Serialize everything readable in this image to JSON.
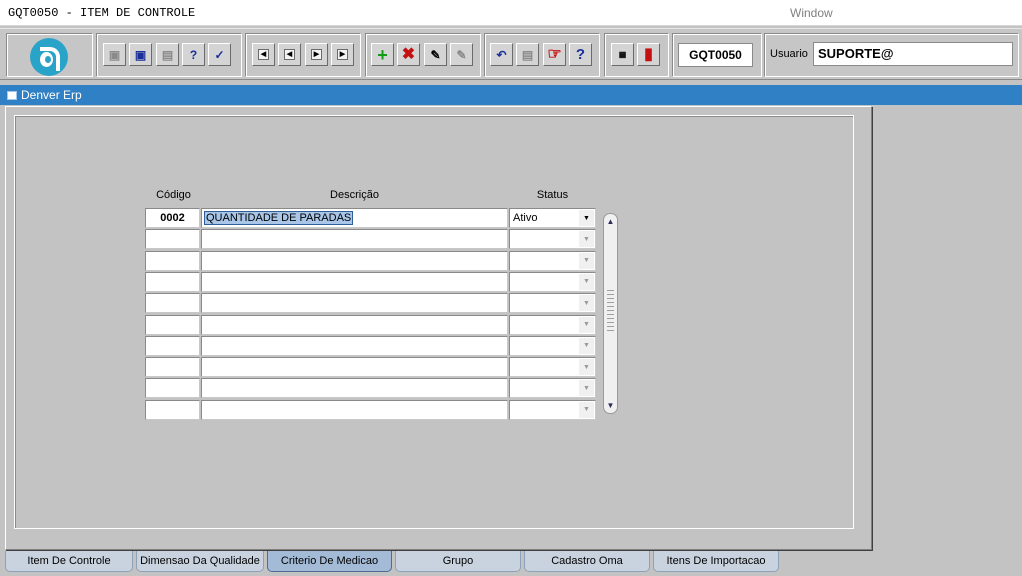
{
  "menubar": {
    "title": "GQT0050 - ITEM DE CONTROLE",
    "window_menu": "Window"
  },
  "toolbar": {
    "form_code": "GQT0050",
    "user_label": "Usuario",
    "user_value": "SUPORTE@",
    "icons": [
      "save-icon",
      "screen-icon",
      "print-icon",
      "query-icon",
      "query-run-icon",
      "first-record-icon",
      "prev-record-icon",
      "next-record-icon",
      "last-record-icon",
      "insert-record-icon",
      "delete-record-icon",
      "edit-record-icon",
      "clear-icon",
      "undo-icon",
      "clipboard-icon",
      "find-icon",
      "help-icon",
      "menu-icon",
      "exit-icon"
    ]
  },
  "window": {
    "title": "Denver Erp"
  },
  "grid": {
    "headers": {
      "code": "Código",
      "description": "Descrição",
      "status": "Status"
    },
    "rows": [
      {
        "code": "0002",
        "description": "QUANTIDADE DE PARADAS",
        "status": "Ativo"
      },
      {
        "code": "",
        "description": "",
        "status": ""
      },
      {
        "code": "",
        "description": "",
        "status": ""
      },
      {
        "code": "",
        "description": "",
        "status": ""
      },
      {
        "code": "",
        "description": "",
        "status": ""
      },
      {
        "code": "",
        "description": "",
        "status": ""
      },
      {
        "code": "",
        "description": "",
        "status": ""
      },
      {
        "code": "",
        "description": "",
        "status": ""
      },
      {
        "code": "",
        "description": "",
        "status": ""
      },
      {
        "code": "",
        "description": "",
        "status": ""
      }
    ]
  },
  "tabs": [
    {
      "label": "Item De Controle",
      "active": false
    },
    {
      "label": "Dimensao Da Qualidade",
      "active": false
    },
    {
      "label": "Criterio De Medicao",
      "active": true
    },
    {
      "label": "Grupo",
      "active": false
    },
    {
      "label": "Cadastro Oma",
      "active": false
    },
    {
      "label": "Itens De Importacao",
      "active": false
    }
  ]
}
